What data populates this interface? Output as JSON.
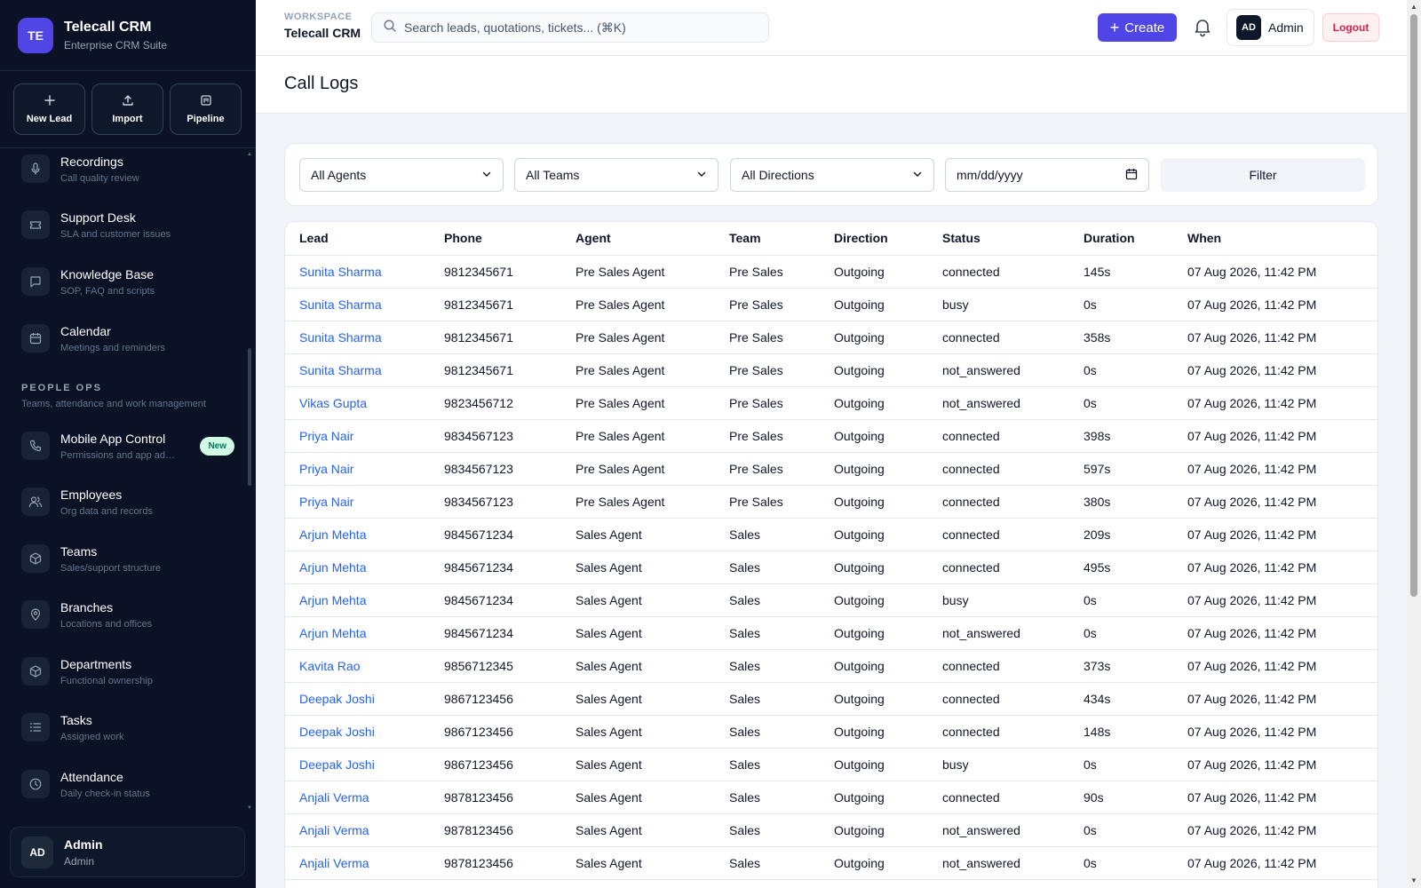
{
  "brand": {
    "initials": "TE",
    "title": "Telecall CRM",
    "subtitle": "Enterprise CRM Suite"
  },
  "quick_actions": [
    {
      "label": "New Lead",
      "icon": "plus-icon"
    },
    {
      "label": "Import",
      "icon": "upload-icon"
    },
    {
      "label": "Pipeline",
      "icon": "pipeline-icon"
    }
  ],
  "nav": {
    "items_top": [
      {
        "title": "Recordings",
        "subtitle": "Call quality review",
        "icon": "microphone-icon"
      },
      {
        "title": "Support Desk",
        "subtitle": "SLA and customer issues",
        "icon": "ticket-icon"
      },
      {
        "title": "Knowledge Base",
        "subtitle": "SOP, FAQ and scripts",
        "icon": "book-icon"
      },
      {
        "title": "Calendar",
        "subtitle": "Meetings and reminders",
        "icon": "calendar-icon"
      }
    ],
    "section": {
      "title": "PEOPLE OPS",
      "subtitle": "Teams, attendance and work management"
    },
    "items_people": [
      {
        "title": "Mobile App Control",
        "subtitle": "Permissions and app ado...",
        "icon": "phone-icon",
        "badge": "New"
      },
      {
        "title": "Employees",
        "subtitle": "Org data and records",
        "icon": "users-icon"
      },
      {
        "title": "Teams",
        "subtitle": "Sales/support structure",
        "icon": "box-icon"
      },
      {
        "title": "Branches",
        "subtitle": "Locations and offices",
        "icon": "map-pin-icon"
      },
      {
        "title": "Departments",
        "subtitle": "Functional ownership",
        "icon": "box-icon"
      },
      {
        "title": "Tasks",
        "subtitle": "Assigned work",
        "icon": "list-icon"
      },
      {
        "title": "Attendance",
        "subtitle": "Daily check-in status",
        "icon": "clock-icon"
      }
    ]
  },
  "user": {
    "initials": "AD",
    "name": "Admin",
    "role": "Admin"
  },
  "header": {
    "workspace_label": "WORKSPACE",
    "workspace_name": "Telecall CRM",
    "search_placeholder": "Search leads, quotations, tickets... (⌘K)",
    "create_label": "Create",
    "admin_initials": "AD",
    "admin_label": "Admin",
    "logout_label": "Logout"
  },
  "page": {
    "title": "Call Logs"
  },
  "filters": {
    "agent": "All Agents",
    "team": "All Teams",
    "direction": "All Directions",
    "date_placeholder": "mm/dd/yyyy",
    "button": "Filter"
  },
  "table": {
    "columns": [
      "Lead",
      "Phone",
      "Agent",
      "Team",
      "Direction",
      "Status",
      "Duration",
      "When"
    ],
    "rows": [
      [
        "Sunita Sharma",
        "9812345671",
        "Pre Sales Agent",
        "Pre Sales",
        "Outgoing",
        "connected",
        "145s",
        "07 Aug 2026, 11:42 PM"
      ],
      [
        "Sunita Sharma",
        "9812345671",
        "Pre Sales Agent",
        "Pre Sales",
        "Outgoing",
        "busy",
        "0s",
        "07 Aug 2026, 11:42 PM"
      ],
      [
        "Sunita Sharma",
        "9812345671",
        "Pre Sales Agent",
        "Pre Sales",
        "Outgoing",
        "connected",
        "358s",
        "07 Aug 2026, 11:42 PM"
      ],
      [
        "Sunita Sharma",
        "9812345671",
        "Pre Sales Agent",
        "Pre Sales",
        "Outgoing",
        "not_answered",
        "0s",
        "07 Aug 2026, 11:42 PM"
      ],
      [
        "Vikas Gupta",
        "9823456712",
        "Pre Sales Agent",
        "Pre Sales",
        "Outgoing",
        "not_answered",
        "0s",
        "07 Aug 2026, 11:42 PM"
      ],
      [
        "Priya Nair",
        "9834567123",
        "Pre Sales Agent",
        "Pre Sales",
        "Outgoing",
        "connected",
        "398s",
        "07 Aug 2026, 11:42 PM"
      ],
      [
        "Priya Nair",
        "9834567123",
        "Pre Sales Agent",
        "Pre Sales",
        "Outgoing",
        "connected",
        "597s",
        "07 Aug 2026, 11:42 PM"
      ],
      [
        "Priya Nair",
        "9834567123",
        "Pre Sales Agent",
        "Pre Sales",
        "Outgoing",
        "connected",
        "380s",
        "07 Aug 2026, 11:42 PM"
      ],
      [
        "Arjun Mehta",
        "9845671234",
        "Sales Agent",
        "Sales",
        "Outgoing",
        "connected",
        "209s",
        "07 Aug 2026, 11:42 PM"
      ],
      [
        "Arjun Mehta",
        "9845671234",
        "Sales Agent",
        "Sales",
        "Outgoing",
        "connected",
        "495s",
        "07 Aug 2026, 11:42 PM"
      ],
      [
        "Arjun Mehta",
        "9845671234",
        "Sales Agent",
        "Sales",
        "Outgoing",
        "busy",
        "0s",
        "07 Aug 2026, 11:42 PM"
      ],
      [
        "Arjun Mehta",
        "9845671234",
        "Sales Agent",
        "Sales",
        "Outgoing",
        "not_answered",
        "0s",
        "07 Aug 2026, 11:42 PM"
      ],
      [
        "Kavita Rao",
        "9856712345",
        "Sales Agent",
        "Sales",
        "Outgoing",
        "connected",
        "373s",
        "07 Aug 2026, 11:42 PM"
      ],
      [
        "Deepak Joshi",
        "9867123456",
        "Sales Agent",
        "Sales",
        "Outgoing",
        "connected",
        "434s",
        "07 Aug 2026, 11:42 PM"
      ],
      [
        "Deepak Joshi",
        "9867123456",
        "Sales Agent",
        "Sales",
        "Outgoing",
        "connected",
        "148s",
        "07 Aug 2026, 11:42 PM"
      ],
      [
        "Deepak Joshi",
        "9867123456",
        "Sales Agent",
        "Sales",
        "Outgoing",
        "busy",
        "0s",
        "07 Aug 2026, 11:42 PM"
      ],
      [
        "Anjali Verma",
        "9878123456",
        "Sales Agent",
        "Sales",
        "Outgoing",
        "connected",
        "90s",
        "07 Aug 2026, 11:42 PM"
      ],
      [
        "Anjali Verma",
        "9878123456",
        "Sales Agent",
        "Sales",
        "Outgoing",
        "not_answered",
        "0s",
        "07 Aug 2026, 11:42 PM"
      ],
      [
        "Anjali Verma",
        "9878123456",
        "Sales Agent",
        "Sales",
        "Outgoing",
        "not_answered",
        "0s",
        "07 Aug 2026, 11:42 PM"
      ]
    ]
  },
  "colors": {
    "sidebar_bg": "#0b1226",
    "accent": "#4f46e5",
    "link": "#2563eb",
    "logout": "#e11d48",
    "badge_new": "#d1fae5"
  }
}
